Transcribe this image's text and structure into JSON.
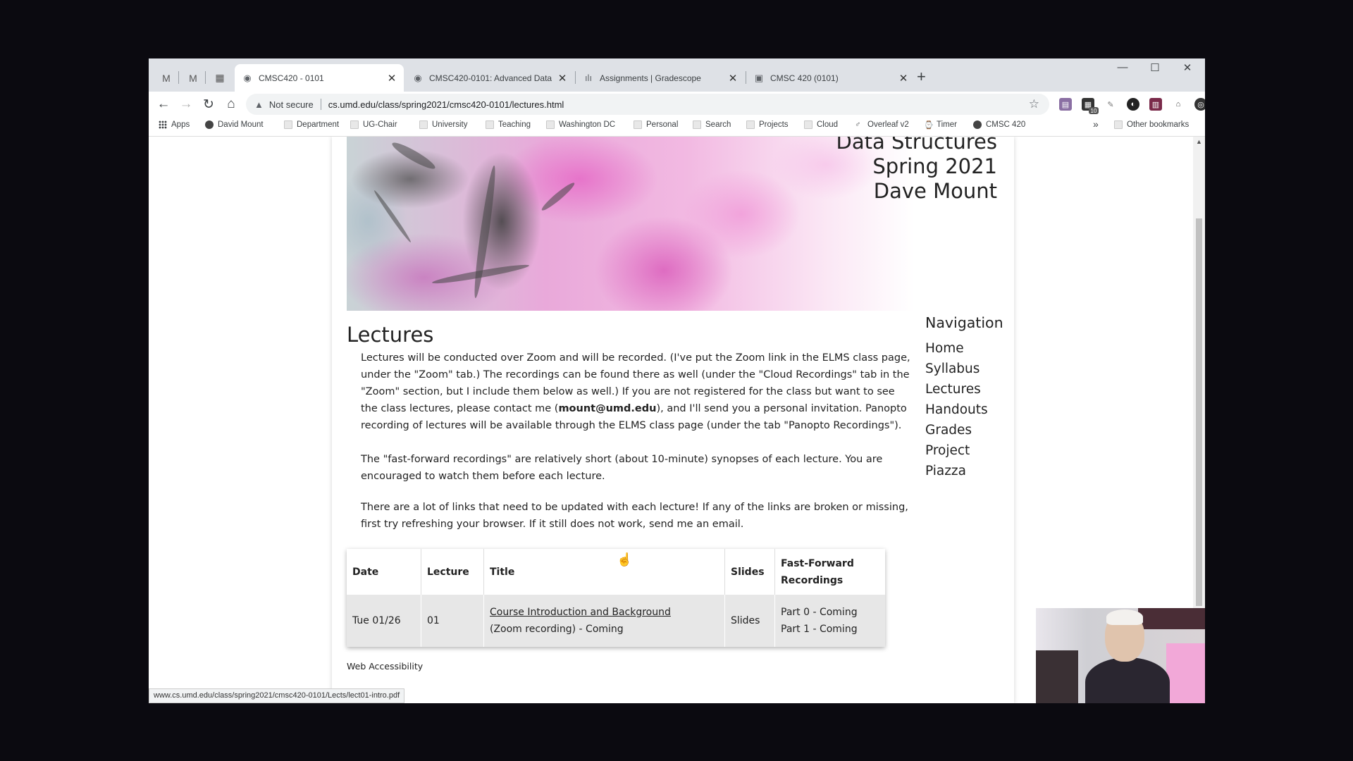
{
  "browser": {
    "pinned_tabs": [
      "gmail-icon",
      "gmail-icon",
      "calendar-icon"
    ],
    "tabs": [
      {
        "title": "CMSC420 - 0101",
        "active": true
      },
      {
        "title": "CMSC420-0101: Advanced Data",
        "active": false
      },
      {
        "title": "Assignments | Gradescope",
        "active": false
      },
      {
        "title": "CMSC 420 (0101)",
        "active": false
      }
    ],
    "security_label": "Not secure",
    "url": "cs.umd.edu/class/spring2021/cmsc420-0101/lectures.html",
    "extension_badge": "10",
    "bookmarks": [
      "Apps",
      "David Mount",
      "Department",
      "UG-Chair",
      "University",
      "Teaching",
      "Washington DC",
      "Personal",
      "Search",
      "Projects",
      "Cloud",
      "Overleaf v2",
      "Timer",
      "CMSC 420"
    ],
    "more_bookmarks": "»",
    "other_bookmarks": "Other bookmarks",
    "status_url": "www.cs.umd.edu/class/spring2021/cmsc420-0101/Lects/lect01-intro.pdf"
  },
  "banner": {
    "line1": "Data Structures",
    "line2": "Spring 2021",
    "line3": "Dave Mount"
  },
  "page": {
    "heading": "Lectures",
    "para1_a": "Lectures will be conducted over Zoom and will be recorded. (I've put the Zoom link in the ELMS class page, under the \"Zoom\" tab.) The recordings can be found there as well (under the \"Cloud Recordings\" tab in the \"Zoom\" section, but I include them below as well.) If you are not registered for the class but want to see the class lectures, please contact me (",
    "para1_email": "mount@umd.edu",
    "para1_b": "), and I'll send you a personal invitation. Panopto recording of lectures will be available through the ELMS class page (under the tab \"Panopto Recordings\").",
    "para2": "The \"fast-forward recordings\" are relatively short (about 10-minute) synopses of each lecture. You are encouraged to watch them before each lecture.",
    "para3": "There are a lot of links that need to be updated with each lecture! If any of the links are broken or missing, first try refreshing your browser. If it still does not work, send me an email.",
    "footer_link": "Web Accessibility"
  },
  "navigation": {
    "title": "Navigation",
    "links": [
      "Home",
      "Syllabus",
      "Lectures",
      "Handouts",
      "Grades",
      "Project",
      "Piazza"
    ]
  },
  "table": {
    "headers": [
      "Date",
      "Lecture",
      "Title",
      "Slides",
      "Fast-Forward Recordings"
    ],
    "rows": [
      {
        "date": "Tue 01/26",
        "lecture": "01",
        "title_link": "Course Introduction and Background",
        "title_sub": "(Zoom recording) - Coming",
        "slides": "Slides",
        "ff1": "Part 0 - Coming",
        "ff2": "Part 1 - Coming"
      }
    ]
  },
  "colors": {
    "tab_strip": "#dee1e6",
    "table_body": "#e7e7e7",
    "accent_pink": "#e9a9da"
  }
}
